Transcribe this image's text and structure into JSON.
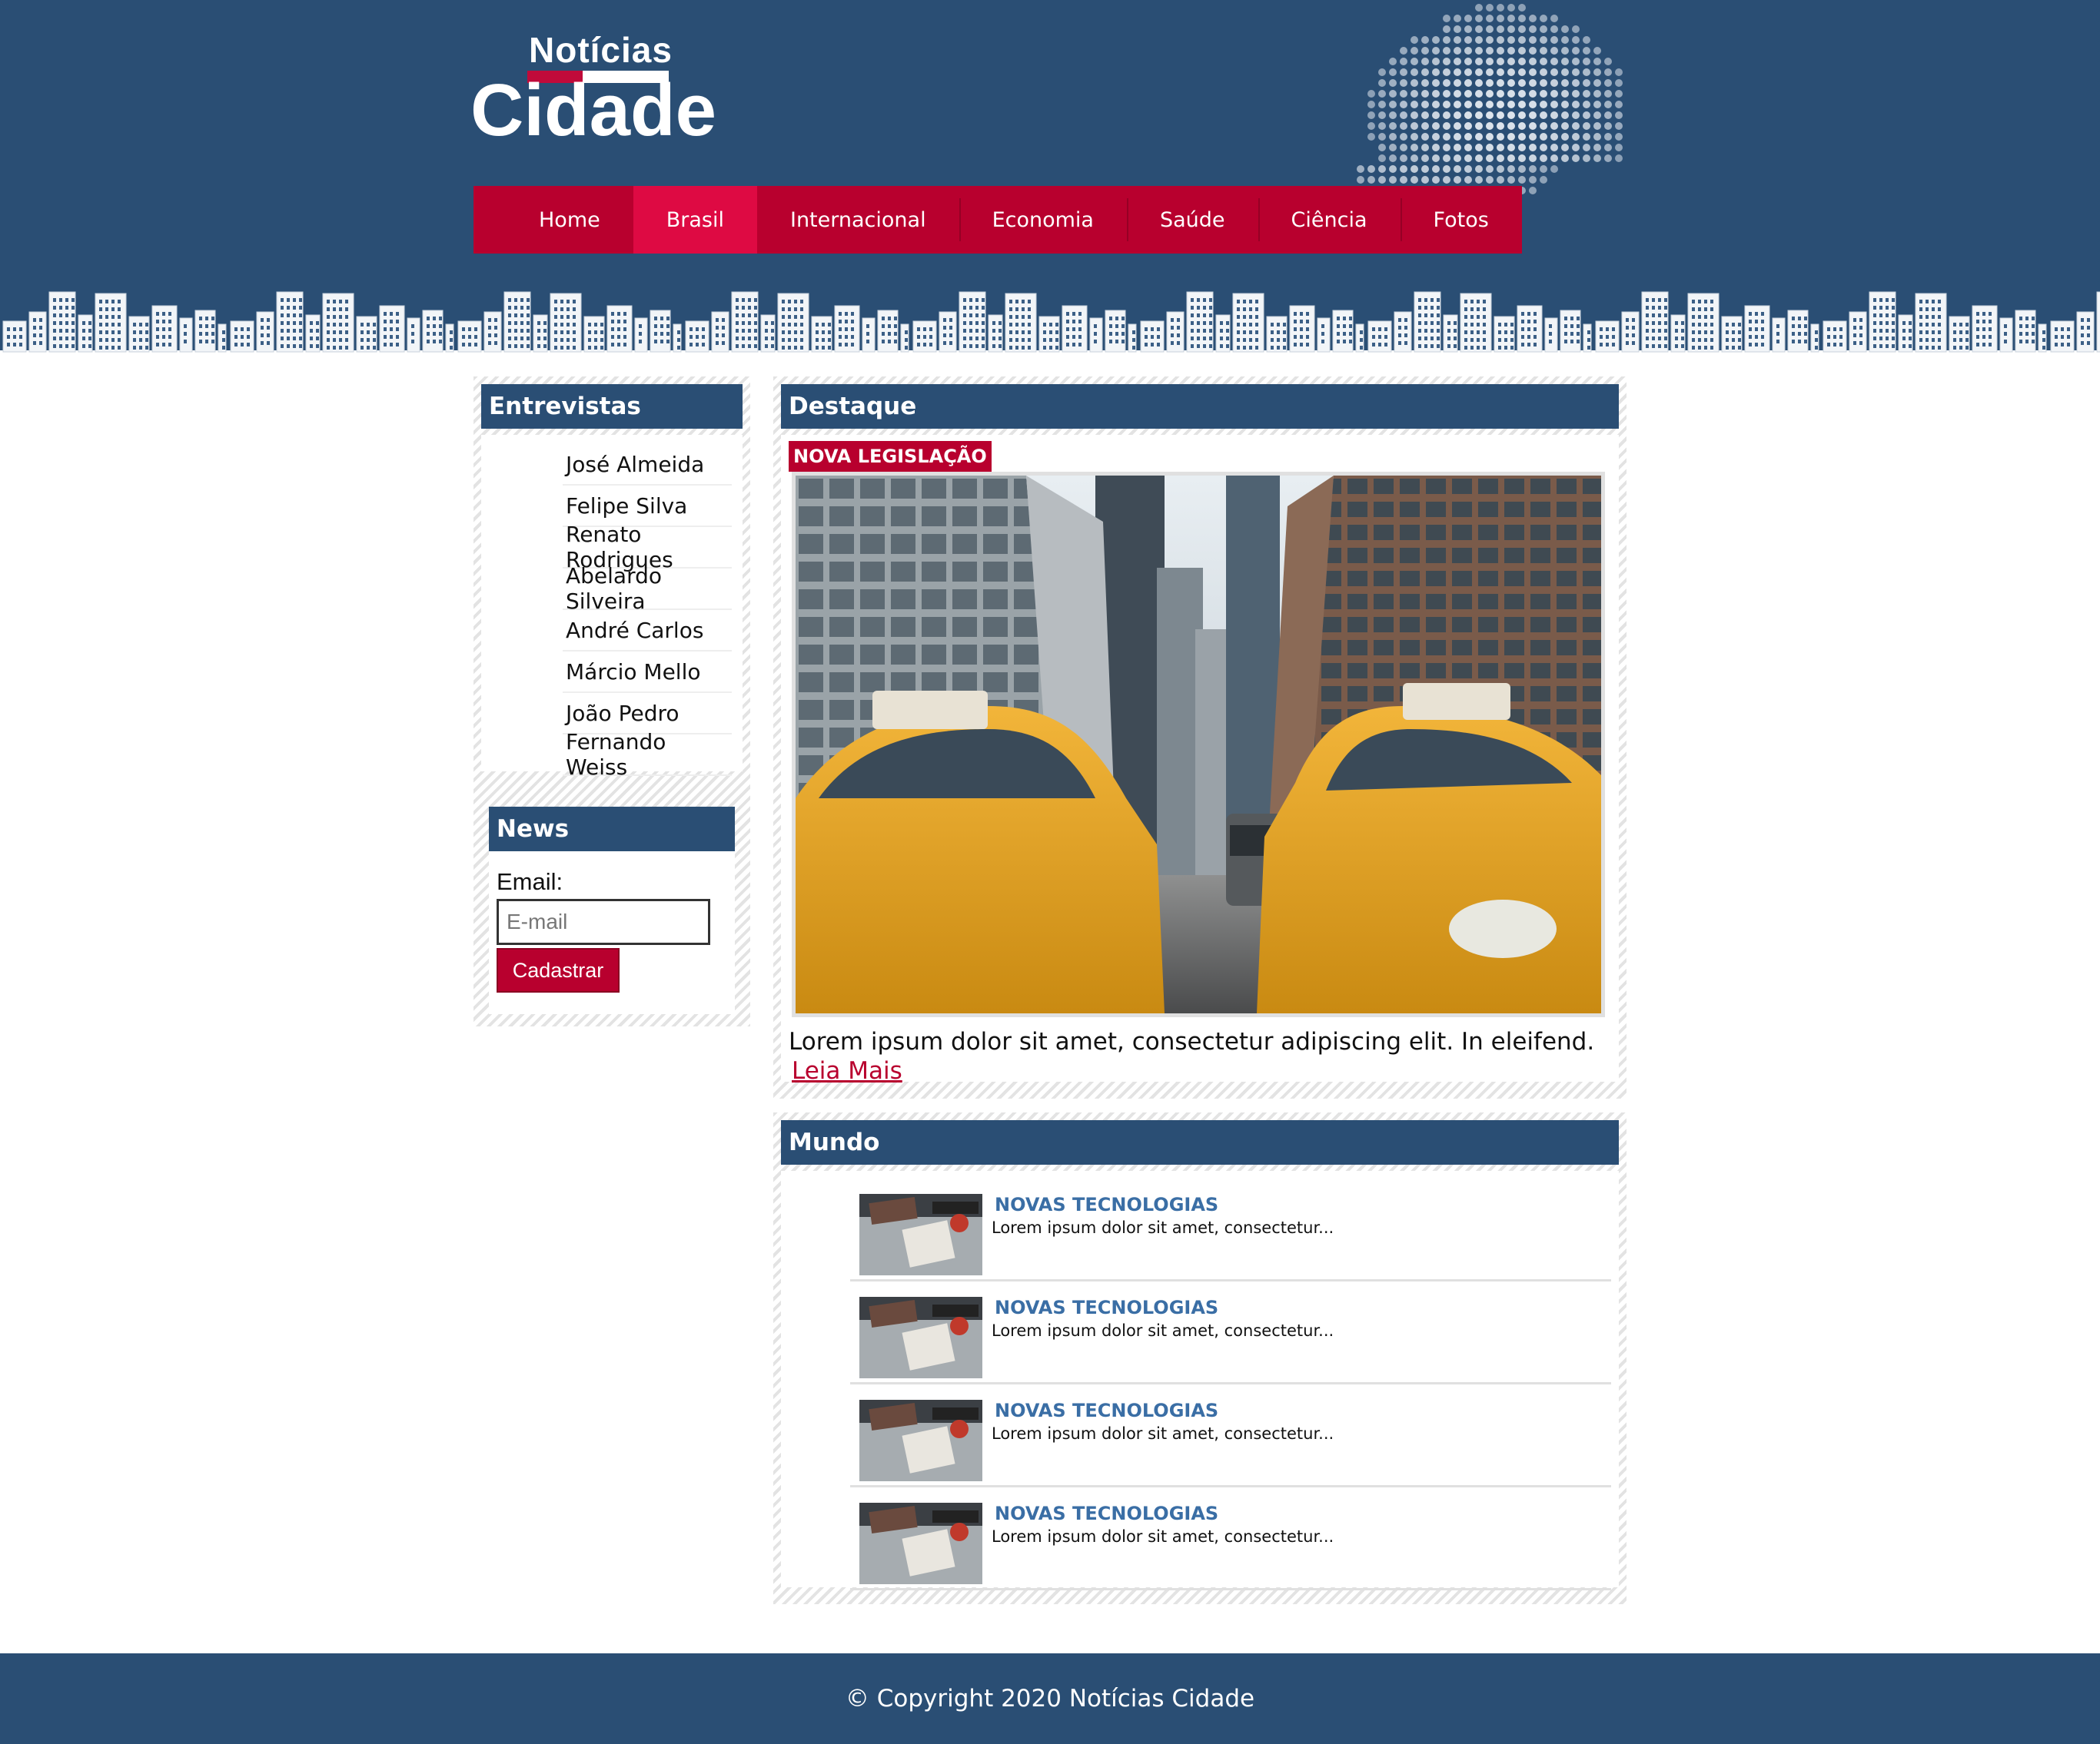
{
  "site": {
    "logo_top": "Notícias",
    "logo_main": "Cidade",
    "colors": {
      "primary": "#2a4e74",
      "accent": "#b8002e",
      "accent_active": "#de0a43",
      "link_blue": "#3a6ea5"
    }
  },
  "nav": {
    "active": "Brasil",
    "items": [
      {
        "label": "Home"
      },
      {
        "label": "Brasil"
      },
      {
        "label": "Internacional"
      },
      {
        "label": "Economia"
      },
      {
        "label": "Saúde"
      },
      {
        "label": "Ciência"
      },
      {
        "label": "Fotos"
      }
    ]
  },
  "sidebar": {
    "interviews_title": "Entrevistas",
    "interviews": [
      {
        "name": "José Almeida"
      },
      {
        "name": "Felipe Silva"
      },
      {
        "name": "Renato Rodrigues"
      },
      {
        "name": "Abelardo Silveira"
      },
      {
        "name": "André Carlos"
      },
      {
        "name": "Márcio Mello"
      },
      {
        "name": "João Pedro"
      },
      {
        "name": "Fernando Weiss"
      }
    ],
    "news": {
      "title": "News",
      "email_label": "Email:",
      "email_placeholder": "E-mail",
      "email_value": "",
      "submit_label": "Cadastrar"
    }
  },
  "featured": {
    "title": "Destaque",
    "badge": "NOVA LEGISLAÇÃO",
    "image": "city-street-yellow-taxis-photo",
    "text": "Lorem ipsum dolor sit amet, consectetur adipiscing elit. In eleifend.",
    "read_more": "Leia Mais"
  },
  "world": {
    "title": "Mundo",
    "items": [
      {
        "title": "NOVAS TECNOLOGIAS",
        "excerpt": "Lorem ipsum dolor sit amet, consectetur...",
        "image": "desk-laptop-notebook-photo"
      },
      {
        "title": "NOVAS TECNOLOGIAS",
        "excerpt": "Lorem ipsum dolor sit amet, consectetur...",
        "image": "desk-laptop-notebook-photo"
      },
      {
        "title": "NOVAS TECNOLOGIAS",
        "excerpt": "Lorem ipsum dolor sit amet, consectetur...",
        "image": "desk-laptop-notebook-photo"
      },
      {
        "title": "NOVAS TECNOLOGIAS",
        "excerpt": "Lorem ipsum dolor sit amet, consectetur...",
        "image": "desk-laptop-notebook-photo"
      }
    ]
  },
  "footer": {
    "copyright": "© Copyright 2020 Notícias Cidade"
  }
}
